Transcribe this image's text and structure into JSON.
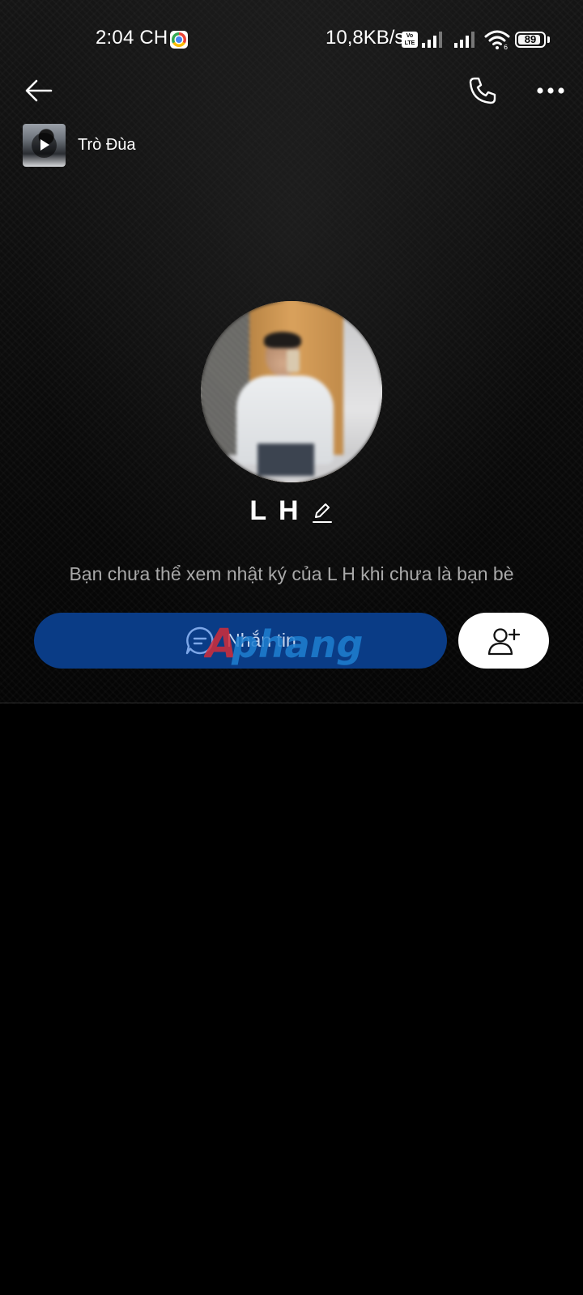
{
  "status_bar": {
    "time": "2:04 CH",
    "net_speed": "10,8KB/s",
    "volte_label": "Vo\nLTE",
    "battery_level": "89",
    "battery_fraction": 0.89,
    "icons": [
      "chrome-icon",
      "volte-icon",
      "signal-icon",
      "signal-icon",
      "wifi-icon",
      "battery-icon"
    ]
  },
  "header": {
    "icons": [
      "back-arrow-icon",
      "phone-icon",
      "more-options-icon"
    ]
  },
  "music": {
    "title": "Trò Đùa",
    "icon": "play-icon"
  },
  "profile": {
    "name": "L H",
    "edit_icon": "pencil-icon",
    "privacy_note": "Bạn chưa thể xem nhật ký của L H khi chưa là bạn bè"
  },
  "actions": {
    "message_label": "Nhắn tin",
    "message_icon": "chat-bubble-icon",
    "add_friend_icon": "add-user-icon"
  },
  "watermark": {
    "text": "Aphang"
  },
  "colors": {
    "message_button": "#0a3c86",
    "add_friend_button": "#ffffff",
    "background": "#000000",
    "secondary_text": "#a9a9a9"
  }
}
